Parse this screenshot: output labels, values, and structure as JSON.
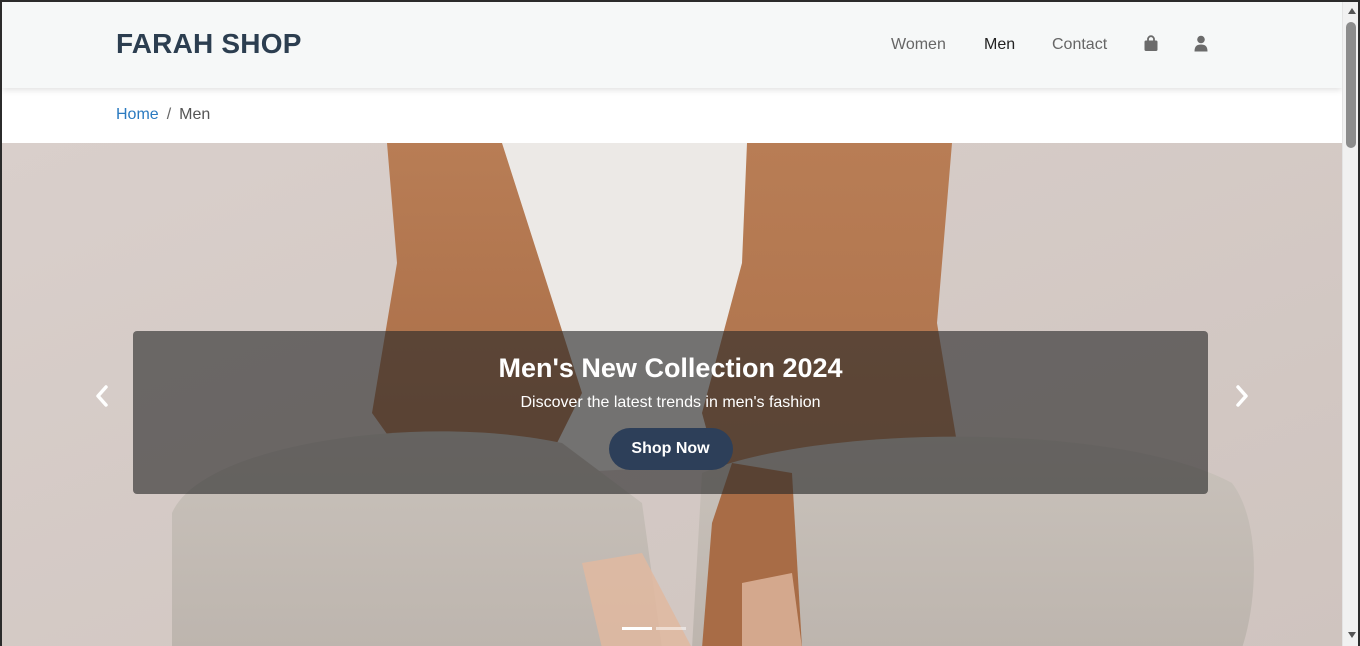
{
  "header": {
    "brand": "FARAH SHOP",
    "nav": [
      {
        "label": "Women",
        "active": false
      },
      {
        "label": "Men",
        "active": true
      },
      {
        "label": "Contact",
        "active": false
      }
    ],
    "icons": [
      "shopping-bag-icon",
      "user-icon"
    ]
  },
  "breadcrumb": {
    "home": "Home",
    "separator": "/",
    "current": "Men"
  },
  "hero": {
    "title": "Men's New Collection 2024",
    "subtitle": "Discover the latest trends in men's fashion",
    "button": "Shop Now",
    "indicators": 2,
    "active_indicator": 0
  },
  "colors": {
    "brand": "#2c3e50",
    "link": "#2a7ac0",
    "button": "#2d3f59"
  }
}
